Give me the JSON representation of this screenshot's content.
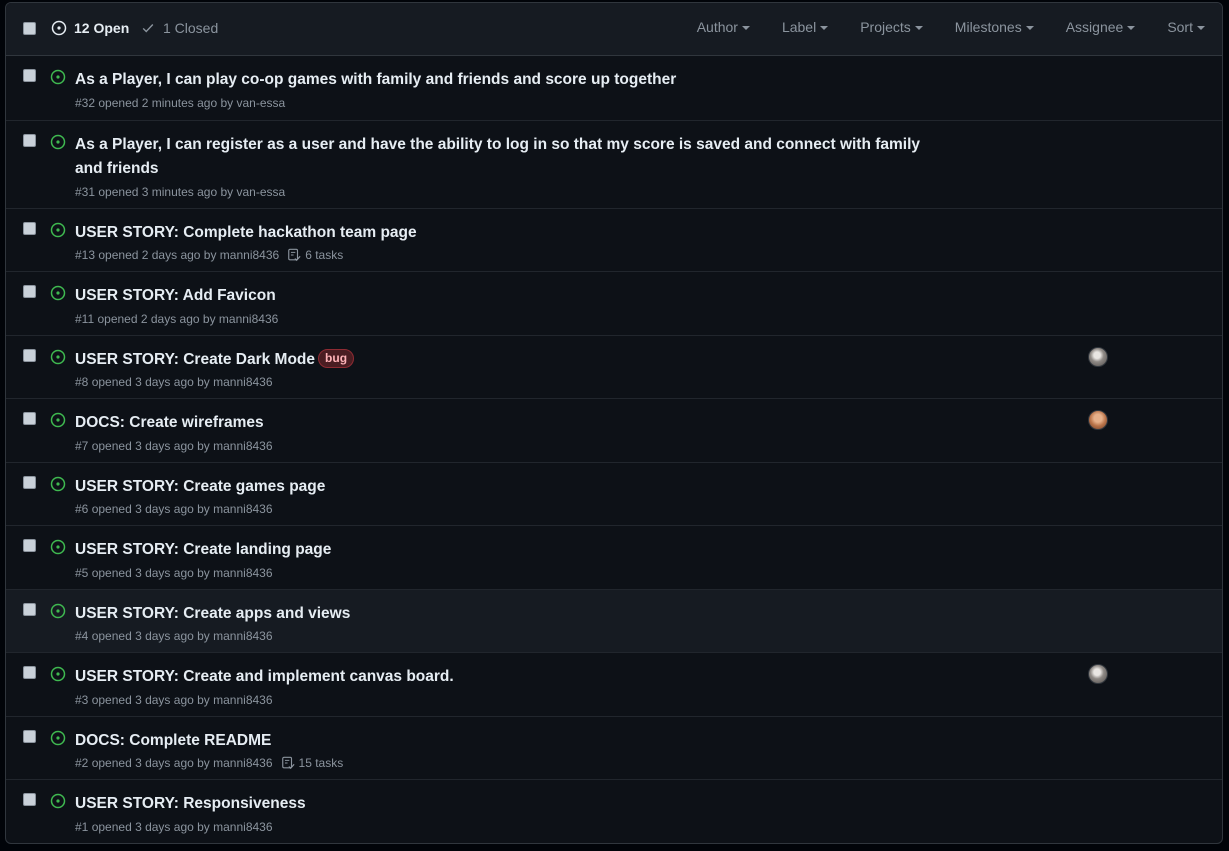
{
  "header": {
    "open_label": "12 Open",
    "closed_label": "1 Closed",
    "filters": [
      {
        "label": "Author"
      },
      {
        "label": "Label"
      },
      {
        "label": "Projects"
      },
      {
        "label": "Milestones"
      },
      {
        "label": "Assignee"
      },
      {
        "label": "Sort"
      }
    ]
  },
  "colors": {
    "open_icon": "#3fb950",
    "bug_label_bg": "#4a1d22",
    "bug_label_text": "#ffb3b8"
  },
  "issues": [
    {
      "title": "As a Player, I can play co-op games with family and friends and score up together",
      "number": "#32",
      "meta": "opened 2 minutes ago by van-essa"
    },
    {
      "title": "As a Player, I can register as a user and have the ability to log in so that my score is saved and connect with family and friends",
      "number": "#31",
      "meta": "opened 3 minutes ago by van-essa"
    },
    {
      "title": "USER STORY: Complete hackathon team page",
      "number": "#13",
      "meta": "opened 2 days ago by manni8436",
      "tasks": "6 tasks"
    },
    {
      "title": "USER STORY: Add Favicon",
      "number": "#11",
      "meta": "opened 2 days ago by manni8436"
    },
    {
      "title": "USER STORY: Create Dark Mode",
      "number": "#8",
      "meta": "opened 3 days ago by manni8436",
      "label": "bug",
      "assignee": "avatar"
    },
    {
      "title": "DOCS: Create wireframes",
      "number": "#7",
      "meta": "opened 3 days ago by manni8436",
      "assignee": "avatar"
    },
    {
      "title": "USER STORY: Create games page",
      "number": "#6",
      "meta": "opened 3 days ago by manni8436"
    },
    {
      "title": "USER STORY: Create landing page",
      "number": "#5",
      "meta": "opened 3 days ago by manni8436"
    },
    {
      "title": "USER STORY: Create apps and views",
      "number": "#4",
      "meta": "opened 3 days ago by manni8436"
    },
    {
      "title": "USER STORY: Create and implement canvas board.",
      "number": "#3",
      "meta": "opened 3 days ago by manni8436",
      "assignee": "avatar"
    },
    {
      "title": "DOCS: Complete README",
      "number": "#2",
      "meta": "opened 3 days ago by manni8436",
      "tasks": "15 tasks"
    },
    {
      "title": "USER STORY: Responsiveness",
      "number": "#1",
      "meta": "opened 3 days ago by manni8436"
    }
  ]
}
